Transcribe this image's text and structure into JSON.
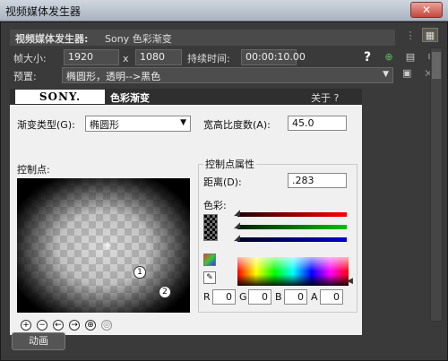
{
  "window": {
    "title": "视频媒体发生器",
    "close": "✕"
  },
  "header": {
    "label": "视频媒体发生器:",
    "value": "Sony 色彩渐变"
  },
  "frame": {
    "label": "帧大小:",
    "width": "1920",
    "x": "x",
    "height": "1080",
    "duration_label": "持续时间:",
    "duration": "00:00:10.00"
  },
  "preset": {
    "label": "预置:",
    "value": "椭圆形，透明-->黑色"
  },
  "plugin": {
    "brand": "SONY.",
    "name": "色彩渐变",
    "about": "关于 ?",
    "gradient_type_label": "渐变类型(G):",
    "gradient_type_value": "椭圆形",
    "aspect_label": "宽高比度数(A):",
    "aspect_value": "45.0",
    "control_points_label": "控制点:",
    "cp_props_label": "控制点属性",
    "distance_label": "距离(D):",
    "distance_value": ".283",
    "color_label": "色彩:",
    "cp1": "1",
    "cp2": "2",
    "rgba": {
      "r_label": "R",
      "r": "0",
      "g_label": "G",
      "g": "0",
      "b_label": "B",
      "b": "0",
      "a_label": "A",
      "a": "0"
    }
  },
  "bottom": {
    "animate_label": "动画"
  },
  "colors": {
    "panel_bg": "#f0f0f0",
    "window_bg": "#3a3a3a",
    "accent_help": "#ffffff"
  }
}
